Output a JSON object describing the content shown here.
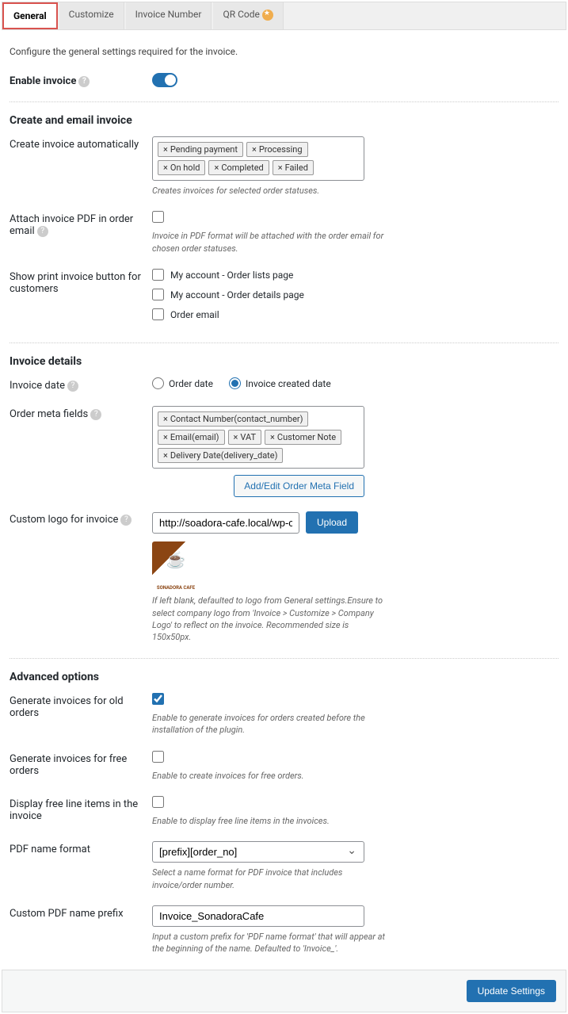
{
  "tabs": {
    "general": "General",
    "customize": "Customize",
    "invoice_number": "Invoice Number",
    "qr_code": "QR Code"
  },
  "intro": "Configure the general settings required for the invoice.",
  "enable_invoice": "Enable invoice",
  "section_create": "Create and email invoice",
  "create_auto": {
    "label": "Create invoice automatically",
    "tags": [
      "Pending payment",
      "Processing",
      "On hold",
      "Completed",
      "Failed"
    ],
    "help": "Creates invoices for selected order statuses."
  },
  "attach_pdf": {
    "label": "Attach invoice PDF in order email",
    "help": "Invoice in PDF format will be attached with the order email for chosen order statuses."
  },
  "show_print": {
    "label": "Show print invoice button for customers",
    "opts": [
      "My account - Order lists page",
      "My account - Order details page",
      "Order email"
    ]
  },
  "section_details": "Invoice details",
  "invoice_date": {
    "label": "Invoice date",
    "opts": [
      "Order date",
      "Invoice created date"
    ]
  },
  "order_meta": {
    "label": "Order meta fields",
    "tags": [
      "Contact Number(contact_number)",
      "Email(email)",
      "VAT",
      "Customer Note",
      "Delivery Date(delivery_date)"
    ],
    "btn": "Add/Edit Order Meta Field"
  },
  "logo": {
    "label": "Custom logo for invoice",
    "value": "http://soadora-cafe.local/wp-content/up",
    "btn": "Upload",
    "brand": "SONADORA CAFE",
    "help": "If left blank, defaulted to logo from General settings.Ensure to select company logo from 'Invoice > Customize > Company Logo' to reflect on the invoice. Recommended size is 150x50px."
  },
  "section_adv": "Advanced options",
  "gen_old": {
    "label": "Generate invoices for old orders",
    "help": "Enable to generate invoices for orders created before the installation of the plugin."
  },
  "gen_free": {
    "label": "Generate invoices for free orders",
    "help": "Enable to create invoices for free orders."
  },
  "disp_free": {
    "label": "Display free line items in the invoice",
    "help": "Enable to display free line items in the invoices."
  },
  "pdf_name": {
    "label": "PDF name format",
    "value": "[prefix][order_no]",
    "help": "Select a name format for PDF invoice that includes invoice/order number."
  },
  "pdf_prefix": {
    "label": "Custom PDF name prefix",
    "value": "Invoice_SonadoraCafe",
    "help": "Input a custom prefix for 'PDF name format' that will appear at the beginning of the name. Defaulted to 'Invoice_'."
  },
  "update_btn": "Update Settings"
}
